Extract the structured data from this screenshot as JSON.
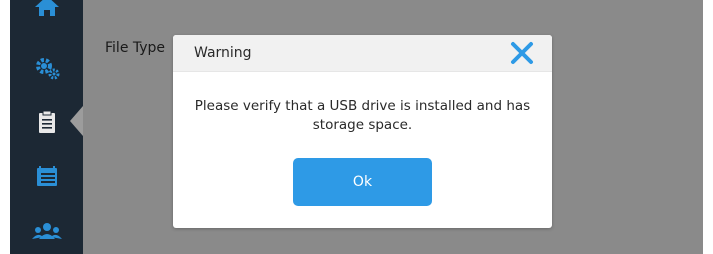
{
  "sidebar": {
    "icons": [
      "home-icon",
      "gears-icon",
      "clipboard-icon",
      "calendar-list-icon",
      "users-icon"
    ],
    "active_index": 2
  },
  "main": {
    "file_type_label": "File Type"
  },
  "dialog": {
    "title": "Warning",
    "message_line1": "Please verify that a USB drive is installed and has",
    "message_line2": "storage space.",
    "ok_label": "Ok",
    "close_icon": "close-icon"
  },
  "colors": {
    "sidebar_bg": "#1c2834",
    "icon_blue": "#2a8fd6",
    "button_blue": "#2e9ae6",
    "overlay_gray": "#8a8a8a"
  }
}
